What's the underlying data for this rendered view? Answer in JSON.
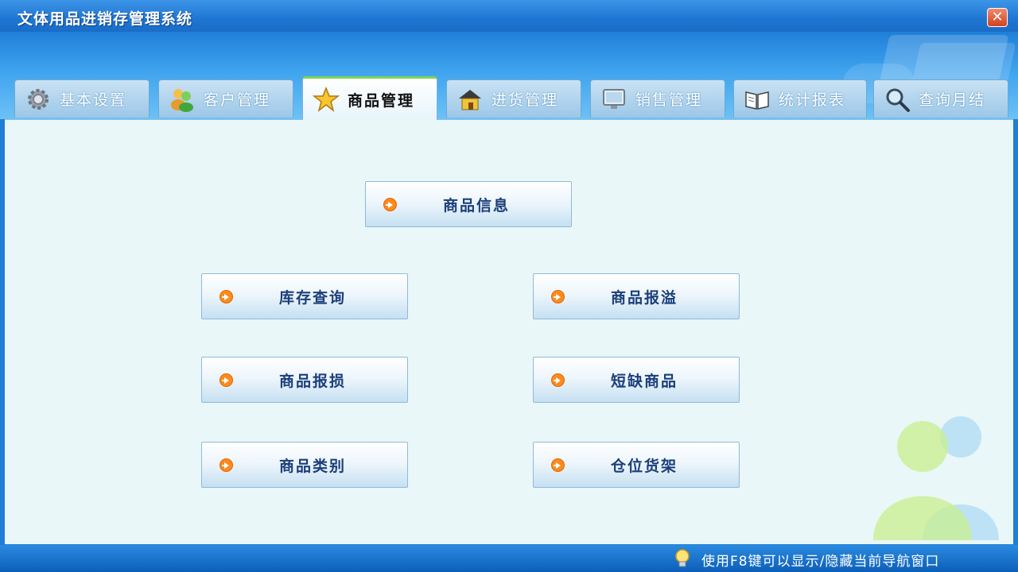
{
  "window": {
    "title": "文体用品进销存管理系统"
  },
  "tabs": [
    {
      "label": "基本设置",
      "icon": "gear-icon",
      "active": false
    },
    {
      "label": "客户管理",
      "icon": "users-icon",
      "active": false
    },
    {
      "label": "商品管理",
      "icon": "star-icon",
      "active": true
    },
    {
      "label": "进货管理",
      "icon": "house-icon",
      "active": false
    },
    {
      "label": "销售管理",
      "icon": "monitor-icon",
      "active": false
    },
    {
      "label": "统计报表",
      "icon": "book-icon",
      "active": false
    },
    {
      "label": "查询月结",
      "icon": "magnifier-icon",
      "active": false
    }
  ],
  "buttons": {
    "product_info": "商品信息",
    "stock_query": "库存查询",
    "product_overflow": "商品报溢",
    "product_loss": "商品报损",
    "shortage": "短缺商品",
    "category": "商品类别",
    "shelf": "仓位货架"
  },
  "status": {
    "hint": "使用F8键可以显示/隐藏当前导航窗口"
  },
  "colors": {
    "accent": "#1f7fd6",
    "content_bg": "#eaf7f8",
    "button_text": "#1b3f7a",
    "arrow": "#ff8a1c"
  }
}
